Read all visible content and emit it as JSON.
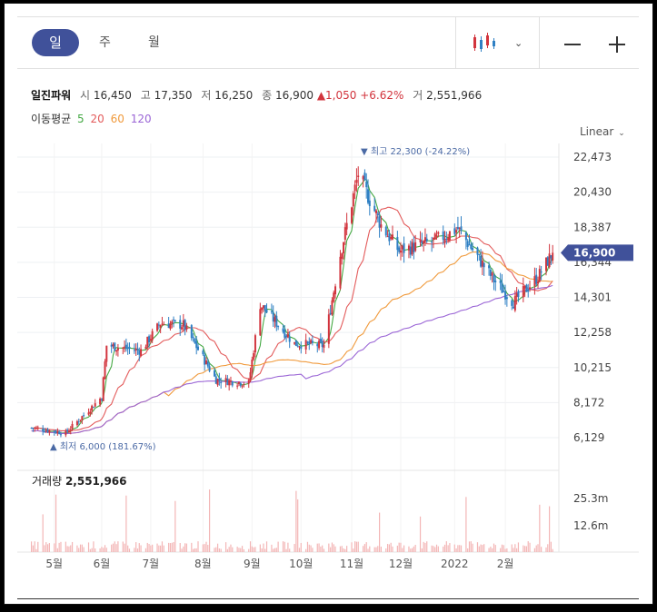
{
  "toolbar": {
    "periods": [
      "일",
      "주",
      "월"
    ],
    "selected_period": "일",
    "chart_type_icon": "candlestick-icon"
  },
  "stock": {
    "name": "일진파워",
    "open_label": "시",
    "open": "16,450",
    "high_label": "고",
    "high": "17,350",
    "low_label": "저",
    "low": "16,250",
    "close_label": "종",
    "close": "16,900",
    "change": "1,050",
    "change_pct": "+6.62%",
    "volume_label": "거",
    "volume": "2,551,966"
  },
  "ma": {
    "label": "이동평균",
    "periods": [
      "5",
      "20",
      "60",
      "120"
    ],
    "colors": [
      "#45a944",
      "#e35b5b",
      "#f09a3c",
      "#9b66d6"
    ]
  },
  "scale": "Linear",
  "price_tag": "16,900",
  "colors": {
    "up": "#d2343d",
    "down": "#2f80c4",
    "accent": "#40519a"
  },
  "chart_data": {
    "type": "candlestick",
    "y_ticks": [
      "22,473",
      "20,430",
      "18,387",
      "16,344",
      "14,301",
      "12,258",
      "10,215",
      "8,172",
      "6,129"
    ],
    "ylim": [
      6129,
      22473
    ],
    "x_ticks": [
      "5월",
      "6월",
      "7월",
      "8월",
      "9월",
      "10월",
      "11월",
      "12월",
      "2022",
      "2월"
    ],
    "max_annotation": "최고 22,300 (-24.22%)",
    "min_annotation": "최저 6,000 (181.67%)",
    "last_close": 16900,
    "volume_label": "거래량",
    "volume_value": "2,551,966",
    "volume_ticks": [
      "25.3m",
      "12.6m"
    ],
    "key_points": [
      {
        "x": "2021-04-19",
        "close": 6700
      },
      {
        "x": "2021-05-10",
        "close": 6400
      },
      {
        "x": "2021-06-01",
        "close": 8500
      },
      {
        "x": "2021-06-04",
        "close": 11500
      },
      {
        "x": "2021-06-25",
        "close": 11200
      },
      {
        "x": "2021-07-07",
        "close": 12800
      },
      {
        "x": "2021-07-21",
        "close": 12700
      },
      {
        "x": "2021-08-10",
        "close": 9500
      },
      {
        "x": "2021-08-30",
        "close": 9300
      },
      {
        "x": "2021-09-06",
        "close": 13900
      },
      {
        "x": "2021-09-27",
        "close": 11600
      },
      {
        "x": "2021-10-15",
        "close": 11500
      },
      {
        "x": "2021-10-25",
        "close": 16800
      },
      {
        "x": "2021-11-05",
        "close": 21500
      },
      {
        "x": "2021-11-19",
        "close": 18500
      },
      {
        "x": "2021-11-30",
        "close": 17000
      },
      {
        "x": "2021-12-22",
        "close": 17600
      },
      {
        "x": "2022-01-05",
        "close": 18300
      },
      {
        "x": "2022-01-27",
        "close": 15300
      },
      {
        "x": "2022-02-08",
        "close": 14000
      },
      {
        "x": "2022-02-23",
        "close": 15500
      },
      {
        "x": "2022-03-04",
        "close": 16900
      }
    ]
  }
}
